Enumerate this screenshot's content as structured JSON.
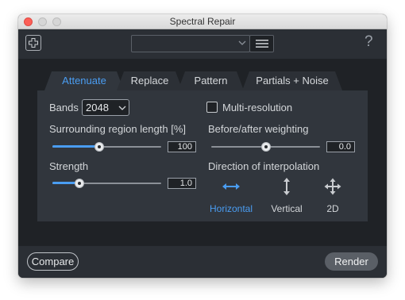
{
  "window": {
    "title": "Spectral Repair"
  },
  "toolbar": {
    "preset_value": "",
    "help_label": "?"
  },
  "tabs": [
    {
      "label": "Attenuate",
      "active": true
    },
    {
      "label": "Replace",
      "active": false
    },
    {
      "label": "Pattern",
      "active": false
    },
    {
      "label": "Partials + Noise",
      "active": false
    }
  ],
  "attenuate": {
    "bands_label": "Bands",
    "bands_value": "2048",
    "multi_resolution_label": "Multi-resolution",
    "multi_resolution_checked": false,
    "surrounding_label": "Surrounding region length [%]",
    "surrounding_value": "100",
    "surrounding_level": 0.43,
    "before_after_label": "Before/after weighting",
    "before_after_value": "0.0",
    "before_after_level": 0.5,
    "strength_label": "Strength",
    "strength_value": "1.0",
    "strength_level": 0.25,
    "direction_label": "Direction of interpolation",
    "directions": [
      {
        "label": "Horizontal",
        "icon": "horizontal-arrows-icon",
        "selected": true
      },
      {
        "label": "Vertical",
        "icon": "vertical-arrows-icon",
        "selected": false
      },
      {
        "label": "2D",
        "icon": "four-way-arrows-icon",
        "selected": false
      }
    ]
  },
  "footer": {
    "compare_label": "Compare",
    "render_label": "Render"
  },
  "colors": {
    "accent": "#4a9df2",
    "background": "#1f2226",
    "panel": "#31363d"
  }
}
